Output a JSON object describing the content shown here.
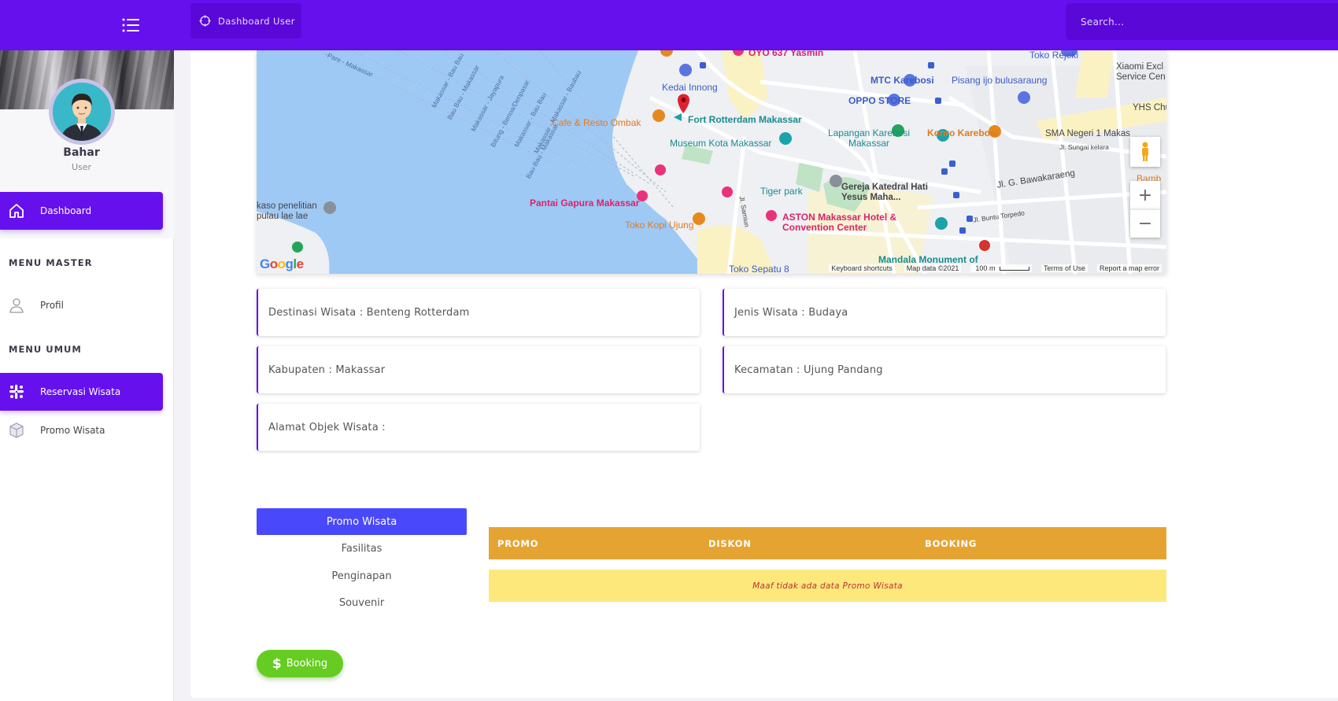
{
  "topbar": {
    "breadcrumb_label": "Dashboard User",
    "search_placeholder": "Search..."
  },
  "user": {
    "name": "Bahar",
    "role": "User"
  },
  "sidebar": {
    "dashboard": "Dashboard",
    "section_master": "MENU MASTER",
    "profil": "Profil",
    "section_umum": "MENU UMUM",
    "reservasi": "Reservasi Wisata",
    "promo": "Promo Wisata"
  },
  "map": {
    "labels": {
      "oyo": "OYO 637 Yasmin",
      "toko_rejeki": "Toko Rejeki",
      "xiaomi": "Xiaomi Excl Service Cen",
      "kedai": "Kedai Innong",
      "mtc": "MTC Karebosi",
      "pisang": "Pisang ijo bulusaraung",
      "oppo": "OPPO STORE",
      "yhs": "YHS Chur",
      "cafe": "Cafe & Resto Ombak",
      "fort": "Fort Rotterdam Makassar",
      "lapangan": "Lapangan Karebosi Makassar",
      "konro": "Konro Karebosi",
      "sma": "SMA Negeri 1 Makas",
      "museum": "Museum Kota Makassar",
      "sungai": "Jl. Sungai kelara",
      "tiger": "Tiger park",
      "gereja": "Gereja Katedral Hati Yesus Maha...",
      "bawakaraeng": "Jl. G. Bawakaraeng",
      "bamb": "Bamb (Nev Bam",
      "pantai": "Pantai Gapura Makassar",
      "kaso": "kaso penelitian pulau lae lae",
      "aston": "ASTON Makassar Hotel & Convention Center",
      "kopi": "Toko Kopi Ujung",
      "samiun": "Jl. Samiun",
      "buntu": "Jl. Buntu Torpedo",
      "mandala": "Mandala Monument of",
      "sepatu": "Toko Sepatu 8",
      "pare": "-Pare - Makassar",
      "road1": "Makassar - Bau Bau",
      "road2": "Bau Bau - Makassar",
      "road3": "Makassar - Jayapura",
      "road4": "Bitung - Benoa/Denpasar",
      "road5": "Makassar - Bau Bau",
      "road6": "Makassar - Makassar - Baubau",
      "road7": "Bau-Bau - Makassar"
    },
    "footer": {
      "keyboard": "Keyboard shortcuts",
      "data": "Map data ©2021",
      "scale": "100 m",
      "terms": "Terms of Use",
      "report": "Report a map error"
    },
    "google": "Google"
  },
  "details": {
    "destinasi": "Destinasi Wisata : Benteng Rotterdam",
    "jenis": "Jenis Wisata : Budaya",
    "kabupaten": "Kabupaten : Makassar",
    "kecamatan": "Kecamatan : Ujung Pandang",
    "alamat": "Alamat Objek Wisata :"
  },
  "tabs": [
    "Promo Wisata",
    "Fasilitas",
    "Penginapan",
    "Souvenir"
  ],
  "table": {
    "headers": [
      "PROMO",
      "DISKON",
      "BOOKING"
    ],
    "empty_message": "Maaf tidak ada data Promo Wisata"
  },
  "booking_button": "Booking",
  "colors": {
    "primary": "#6610ee",
    "tab_active": "#4949fb",
    "table_header": "#e5a432",
    "empty_row": "#fde97b",
    "booking": "#66cc22"
  }
}
